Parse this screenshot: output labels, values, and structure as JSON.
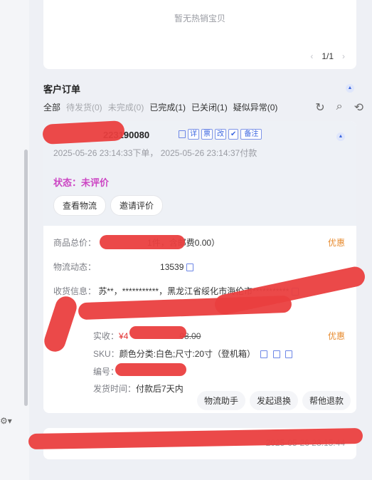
{
  "hot_items": {
    "empty_text": "暂无热销宝贝",
    "page": "1/1"
  },
  "orders": {
    "title": "客户订单",
    "filters": [
      {
        "label": "全部",
        "state": "active"
      },
      {
        "label": "待发货(0)",
        "state": "disabled"
      },
      {
        "label": "未完成(0)",
        "state": "disabled"
      },
      {
        "label": "已完成(1)",
        "state": "active"
      },
      {
        "label": "已关闭(1)",
        "state": "active"
      },
      {
        "label": "疑似异常(0)",
        "state": "active"
      }
    ],
    "order_id_visible": "223190080",
    "badges": [
      "详",
      "票",
      "改",
      "✔",
      "备注"
    ],
    "time_text": "2025-05-26 23:14:33下单， 2025-05-26 23:14:37付款",
    "status": "状态：未评价",
    "action_logistics": "查看物流",
    "action_invite": "邀请评价",
    "product_total_label": "商品总价：",
    "product_total_value": "1件，含邮费0.00）",
    "discount_label": "优惠",
    "logistics_label": "物流动态：",
    "logistics_value": "13539",
    "address_label": "收货信息：",
    "address_value": "苏**，***********，黑龙江省绥化市海伦市***********",
    "paid_label": "实收：",
    "paid_value": "¥4",
    "paid_orig": "98.00",
    "sku_label": "SKU：",
    "sku_value": "颜色分类:白色;尺寸:20寸（登机箱）",
    "code_label": "编号：",
    "ship_label": "发货时间：",
    "ship_value": "付款后7天内",
    "btn_assistant": "物流助手",
    "btn_return": "发起退换",
    "btn_refund": "帮他退款",
    "footer_text": "2025-05-26 23:15:44"
  },
  "colors": {
    "accent": "#3c67e0",
    "status": "#cc45c3",
    "price": "#e33030",
    "discount": "#e78b2f"
  }
}
